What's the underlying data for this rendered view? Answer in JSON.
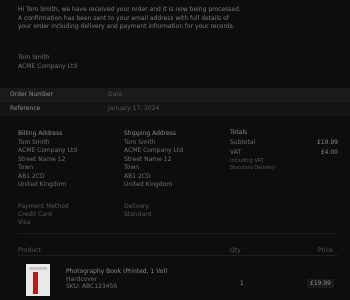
{
  "intro": {
    "line1": "Hi Tom Smith, we have received your order and it is now being processed.",
    "line2": "A confirmation has been sent to your email address with full details of",
    "line3": "your order including delivery and payment information for your records."
  },
  "contact": {
    "name": "Tom Smith",
    "org": "ACME Company Ltd",
    "reference": "Reference"
  },
  "order": {
    "number_label": "Order Number",
    "date_label": "Date",
    "number": "Reference",
    "date": "January 17, 2024"
  },
  "billing": {
    "title": "Billing Address",
    "lines": [
      "Tom Smith",
      "ACME Company Ltd",
      "Street Name 12",
      "Town",
      "AB1 2CD",
      "United Kingdom"
    ]
  },
  "shipping": {
    "title": "Shipping Address",
    "lines": [
      "Tom Smith",
      "ACME Company Ltd",
      "Street Name 12",
      "Town",
      "AB1 2CD",
      "United Kingdom"
    ]
  },
  "summary": {
    "title": "Totals",
    "subtotal_label": "Subtotal",
    "subtotal": "£19.99",
    "tax_label": "VAT",
    "tax": "£4.00",
    "note1": "Including VAT",
    "note2": "Standard Delivery"
  },
  "payment": {
    "label": "Payment Method",
    "value1": "Credit Card",
    "value2": "Visa"
  },
  "delivery": {
    "label": "Delivery",
    "value": "Standard"
  },
  "items_header": {
    "product": "Product",
    "qty": "Qty",
    "price": "Price"
  },
  "item": {
    "title": "Photography Book (Printed, 1 Vol)",
    "subtitle": "Hardcover",
    "sku": "SKU: ABC123456",
    "qty": "1",
    "price": "£19.99"
  },
  "colors": {
    "background": "#0d0d0d",
    "band": "#151515",
    "thumb_stripe": "#b01d1d"
  }
}
